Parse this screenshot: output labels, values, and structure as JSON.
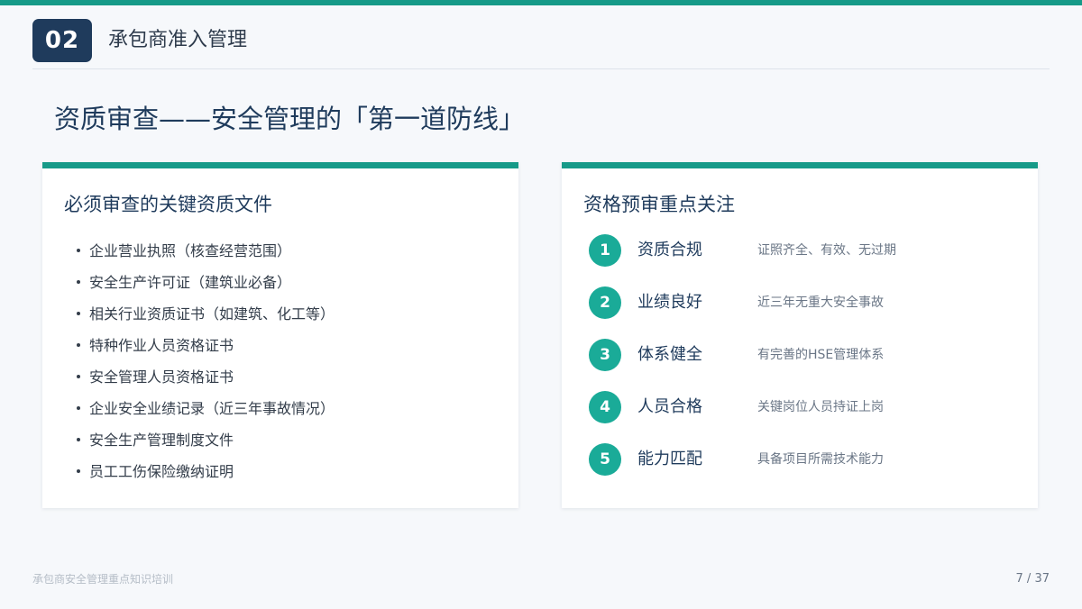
{
  "header": {
    "section_number": "02",
    "section_title": "承包商准入管理"
  },
  "slide_title": "资质审查——安全管理的「第一道防线」",
  "left_card": {
    "title": "必须审查的关键资质文件",
    "items": [
      "企业营业执照（核查经营范围）",
      "安全生产许可证（建筑业必备）",
      "相关行业资质证书（如建筑、化工等）",
      "特种作业人员资格证书",
      "安全管理人员资格证书",
      "企业安全业绩记录（近三年事故情况）",
      "安全生产管理制度文件",
      "员工工伤保险缴纳证明"
    ]
  },
  "right_card": {
    "title": "资格预审重点关注",
    "items": [
      {
        "num": "1",
        "label": "资质合规",
        "desc": "证照齐全、有效、无过期"
      },
      {
        "num": "2",
        "label": "业绩良好",
        "desc": "近三年无重大安全事故"
      },
      {
        "num": "3",
        "label": "体系健全",
        "desc": "有完善的HSE管理体系"
      },
      {
        "num": "4",
        "label": "人员合格",
        "desc": "关键岗位人员持证上岗"
      },
      {
        "num": "5",
        "label": "能力匹配",
        "desc": "具备项目所需技术能力"
      }
    ]
  },
  "footer": {
    "course_title": "承包商安全管理重点知识培训",
    "page_indicator": "7 / 37"
  },
  "colors": {
    "accent": "#169a88",
    "circle": "#1aab98",
    "navy": "#1f3b5c"
  }
}
